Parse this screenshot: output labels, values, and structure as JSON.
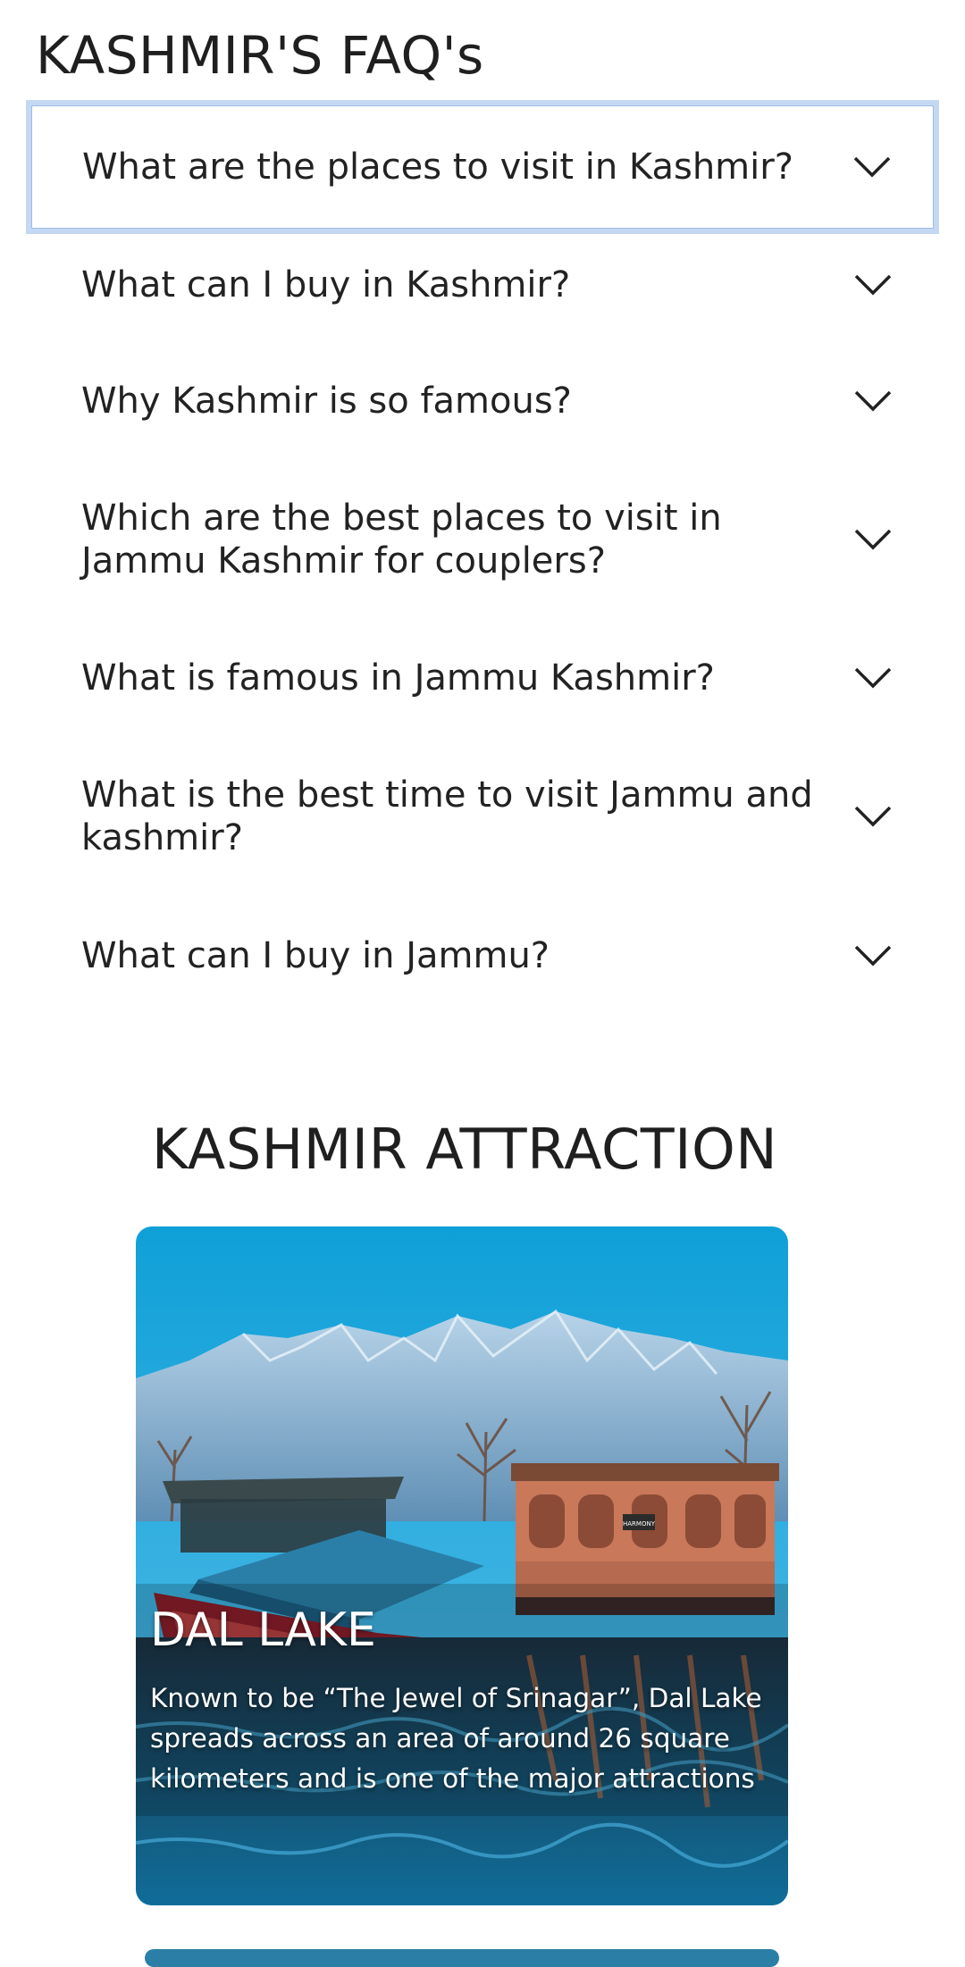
{
  "faq": {
    "title": "KASHMIR'S FAQ's",
    "items": [
      {
        "question": "What are the places to visit in Kashmir?"
      },
      {
        "question": "What can I buy in Kashmir?"
      },
      {
        "question": "Why Kashmir is so famous?"
      },
      {
        "question": "Which are the best places to visit in Jammu Kashmir for couplers?"
      },
      {
        "question": "What is famous in Jammu Kashmir?"
      },
      {
        "question": "What is the best time to visit Jammu and kashmir?"
      },
      {
        "question": "What can I buy in Jammu?"
      }
    ]
  },
  "attractions": {
    "title": "KASHMIR ATTRACTION",
    "cards": [
      {
        "name": "DAL LAKE",
        "description": "Known to be “The Jewel of Srinagar”, Dal Lake spreads across an area of around 26 square kilometers and is one of the major attractions",
        "houseboat_sign": "HARMONY"
      }
    ]
  },
  "colors": {
    "focus_ring": "#c4d8f3",
    "text": "#222222",
    "sky": "#1aa3d8",
    "next_card": "#2b7fa6"
  },
  "icons": {
    "accordion_toggle": "chevron-down-icon"
  }
}
